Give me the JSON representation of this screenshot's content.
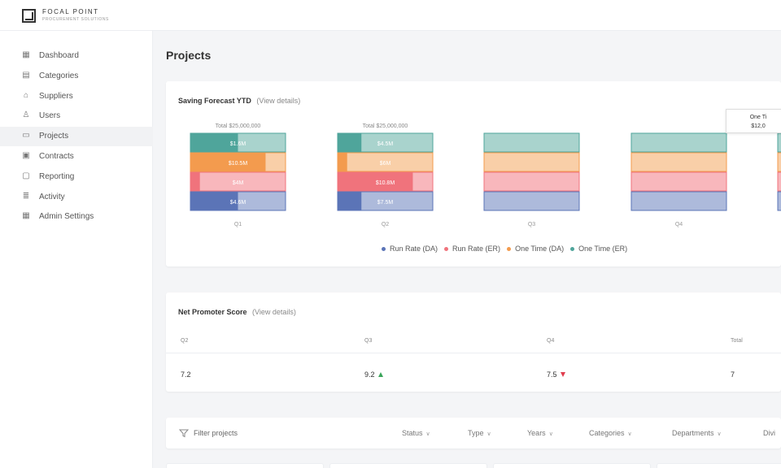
{
  "brand": {
    "name": "FOCAL POINT",
    "subtitle": "PROCUREMENT SOLUTIONS"
  },
  "sidebar": {
    "items": [
      {
        "label": "Dashboard",
        "icon": "dashboard-icon",
        "glyph": "▦",
        "active": false
      },
      {
        "label": "Categories",
        "icon": "categories-icon",
        "glyph": "▤",
        "active": false
      },
      {
        "label": "Suppliers",
        "icon": "suppliers-icon",
        "glyph": "⌂",
        "active": false
      },
      {
        "label": "Users",
        "icon": "user-icon",
        "glyph": "♙",
        "active": false
      },
      {
        "label": "Projects",
        "icon": "projects-icon",
        "glyph": "▭",
        "active": true
      },
      {
        "label": "Contracts",
        "icon": "contracts-icon",
        "glyph": "▣",
        "active": false
      },
      {
        "label": "Reporting",
        "icon": "reporting-icon",
        "glyph": "▢",
        "active": false
      },
      {
        "label": "Activity",
        "icon": "activity-icon",
        "glyph": "≣",
        "active": false
      },
      {
        "label": "Admin Settings",
        "icon": "admin-settings-icon",
        "glyph": "▦",
        "active": false
      }
    ]
  },
  "page": {
    "title": "Projects"
  },
  "forecast": {
    "title": "Saving Forecast YTD",
    "link": "(View details)",
    "tooltip": {
      "line1": "One Ti",
      "line2": "$12,0"
    }
  },
  "chart_data": {
    "type": "bar",
    "stacked": true,
    "categories": [
      "Q1",
      "Q2",
      "Q3",
      "Q4"
    ],
    "totals": [
      "Total $25,000,000",
      "Total $25,000,000",
      "",
      ""
    ],
    "segment_order_top_to_bottom": [
      "One Time (ER)",
      "One Time (DA)",
      "Run Rate (ER)",
      "Run Rate (DA)"
    ],
    "series": [
      {
        "name": "One Time (ER)",
        "color": "#4fa59b",
        "light": "#a9d3cd",
        "labels": [
          "$1.6M",
          "$4.5M",
          "",
          ""
        ],
        "fill": [
          0.5,
          0.25,
          0,
          0
        ]
      },
      {
        "name": "One Time (DA)",
        "color": "#f39b4e",
        "light": "#f9cfa8",
        "labels": [
          "$10.5M",
          "$6M",
          "",
          ""
        ],
        "fill": [
          0.79,
          0.1,
          0,
          0
        ]
      },
      {
        "name": "Run Rate (ER)",
        "color": "#f0737c",
        "light": "#f8b7bc",
        "labels": [
          "$4M",
          "$10.8M",
          "",
          ""
        ],
        "fill": [
          0.1,
          0.79,
          0,
          0
        ]
      },
      {
        "name": "Run Rate (DA)",
        "color": "#5b74b7",
        "light": "#adbadb",
        "labels": [
          "$4.6M",
          "$7.5M",
          "",
          ""
        ],
        "fill": [
          0.5,
          0.25,
          0,
          0
        ]
      }
    ],
    "legend": [
      {
        "name": "Run Rate (DA)",
        "color": "#5b74b7"
      },
      {
        "name": "Run Rate (ER)",
        "color": "#f0737c"
      },
      {
        "name": "One Time (DA)",
        "color": "#f39b4e"
      },
      {
        "name": "One Time (ER)",
        "color": "#4fa59b"
      }
    ],
    "legend_position": "bottom"
  },
  "nps": {
    "title": "Net Promoter Score",
    "link": "(View details)",
    "columns": [
      "Q2",
      "Q3",
      "Q4",
      "Total"
    ],
    "values": [
      "7.2",
      "9.2",
      "7.5",
      "7"
    ]
  },
  "filters": {
    "search_label": "Filter projects",
    "dropdowns": [
      "Status",
      "Type",
      "Years",
      "Categories",
      "Departments",
      "Divi"
    ]
  }
}
